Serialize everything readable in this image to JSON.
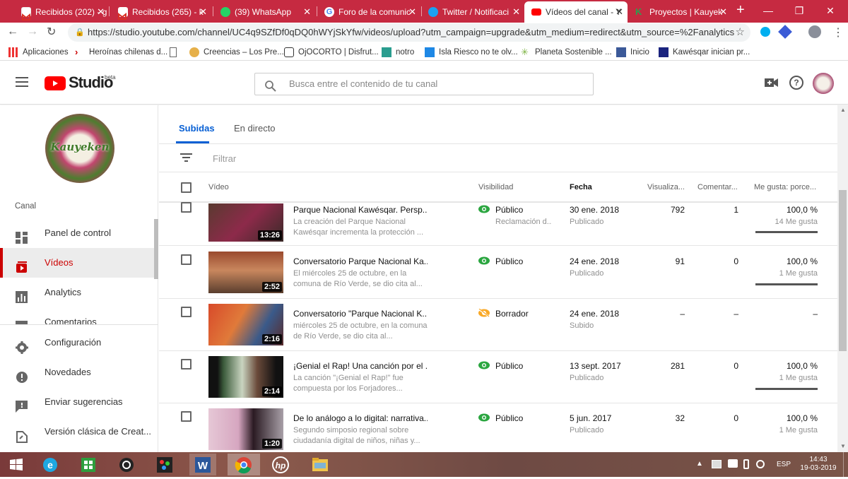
{
  "browser": {
    "tabs": [
      {
        "label": "Recibidos (202) - g",
        "icon": "gmail-icon"
      },
      {
        "label": "Recibidos (265) - k",
        "icon": "gmail-icon"
      },
      {
        "label": "(39) WhatsApp",
        "icon": "whatsapp-icon"
      },
      {
        "label": "Foro de la comunic",
        "icon": "google-icon"
      },
      {
        "label": "Twitter / Notificaci",
        "icon": "twitter-icon"
      },
      {
        "label": "Vídeos del canal - Y",
        "icon": "youtube-icon"
      },
      {
        "label": "Proyectos | Kauyek",
        "icon": "kauyeken-icon"
      }
    ],
    "url": "https://studio.youtube.com/channel/UC4q9SZfDf0qDQ0hWYjSkYfw/videos/upload?utm_campaign=upgrade&utm_medium=redirect&utm_source=%2Fanalytics",
    "bookmarks": [
      "Aplicaciones",
      "Heroínas chilenas d...",
      "",
      "Creencias – Los Pre...",
      "OjOCORTO | Disfrut...",
      "notro",
      "Isla Riesco no te olv...",
      "Planeta Sostenible ...",
      "Inicio",
      "Kawésqar inician pr..."
    ]
  },
  "header": {
    "logo_text": "Studio",
    "logo_badge": "beta",
    "search_placeholder": "Busca entre el contenido de tu canal"
  },
  "sidebar": {
    "channel_logo_text": "Kauyeken",
    "section_label": "Canal",
    "items": [
      {
        "label": "Panel de control",
        "icon": "dashboard-icon"
      },
      {
        "label": "Vídeos",
        "icon": "videos-icon"
      },
      {
        "label": "Analytics",
        "icon": "analytics-icon"
      },
      {
        "label": "Comentarios",
        "icon": "comments-icon"
      }
    ],
    "bottom_items": [
      {
        "label": "Configuración",
        "icon": "gear-icon"
      },
      {
        "label": "Novedades",
        "icon": "news-icon"
      },
      {
        "label": "Enviar sugerencias",
        "icon": "feedback-icon"
      },
      {
        "label": "Versión clásica de Creat...",
        "icon": "classic-icon"
      }
    ]
  },
  "main": {
    "tabs": [
      "Subidas",
      "En directo"
    ],
    "filter_placeholder": "Filtrar",
    "columns": [
      "Vídeo",
      "Visibilidad",
      "Fecha",
      "Visualiza...",
      "Comentar...",
      "Me gusta: porce..."
    ],
    "rows": [
      {
        "title": "Parque Nacional Kawésqar. Persp...",
        "desc": "La creación del Parque Nacional Kawésqar incrementa la protección ...",
        "duration": "13:26",
        "visibility": "Público",
        "visibility_sub": "Reclamación d...",
        "date": "30 ene. 2018",
        "date_sub": "Publicado",
        "views": "792",
        "comments": "1",
        "likes_pct": "100,0 %",
        "likes_count": "14 Me gusta",
        "likes_fraction": 1.0
      },
      {
        "title": "Conversatorio Parque Nacional Ka...",
        "desc": "El miércoles 25 de octubre, en la comuna de Río Verde, se dio cita al...",
        "duration": "2:52",
        "visibility": "Público",
        "visibility_sub": "",
        "date": "24 ene. 2018",
        "date_sub": "Publicado",
        "views": "91",
        "comments": "0",
        "likes_pct": "100,0 %",
        "likes_count": "1 Me gusta",
        "likes_fraction": 1.0
      },
      {
        "title": "Conversatorio \"Parque Nacional K...",
        "desc": "miércoles 25 de octubre, en la comuna de Río Verde, se dio cita al...",
        "duration": "2:16",
        "visibility": "Borrador",
        "visibility_sub": "",
        "date": "24 ene. 2018",
        "date_sub": "Subido",
        "views": "–",
        "comments": "–",
        "likes_pct": "–",
        "likes_count": "",
        "likes_fraction": 0
      },
      {
        "title": "¡Genial el Rap! Una canción por el ...",
        "desc": "La canción \"¡Genial el Rap!\" fue compuesta por los Forjadores...",
        "duration": "2:14",
        "visibility": "Público",
        "visibility_sub": "",
        "date": "13 sept. 2017",
        "date_sub": "Publicado",
        "views": "281",
        "comments": "0",
        "likes_pct": "100,0 %",
        "likes_count": "1 Me gusta",
        "likes_fraction": 1.0
      },
      {
        "title": "De lo análogo a lo digital: narrativa...",
        "desc": "Segundo simposio regional sobre ciudadanía digital de niños, niñas y...",
        "duration": "1:20",
        "visibility": "Público",
        "visibility_sub": "",
        "date": "5 jun. 2017",
        "date_sub": "Publicado",
        "views": "32",
        "comments": "0",
        "likes_pct": "100,0 %",
        "likes_count": "1 Me gusta",
        "likes_fraction": 1.0
      }
    ]
  },
  "taskbar": {
    "lang": "ESP",
    "time": "14:43",
    "date": "19-03-2019"
  },
  "colors": {
    "brand_red": "#ff0000",
    "accent_blue": "#065fd4",
    "visible_green": "#2ba640",
    "draft_orange": "#f9a825",
    "tabstrip": "#c62a41"
  }
}
